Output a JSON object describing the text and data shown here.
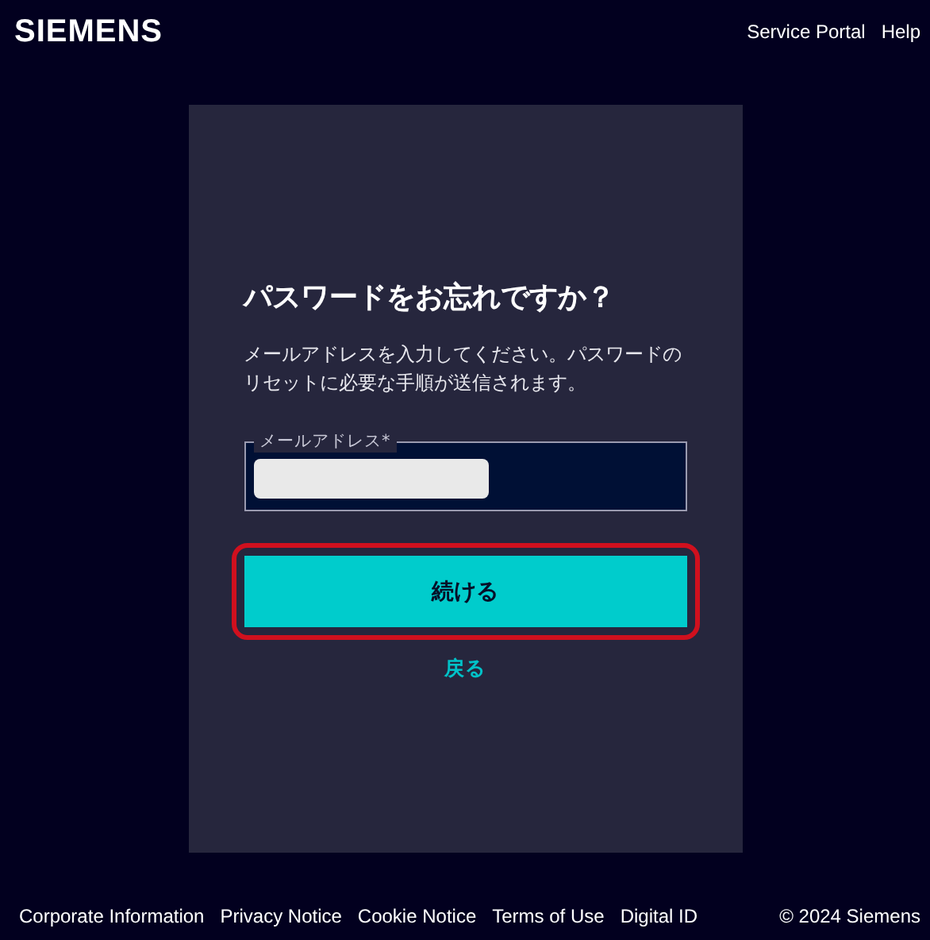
{
  "header": {
    "logo": "SIEMENS",
    "links": [
      "Service Portal",
      "Help"
    ]
  },
  "card": {
    "title": "パスワードをお忘れですか？",
    "description": "メールアドレスを入力してください。パスワードのリセットに必要な手順が送信されます。",
    "email_field": {
      "label": "メールアドレス*",
      "value_redacted": true
    },
    "continue_button": {
      "label": "続ける",
      "highlighted": true
    },
    "back_link": "戻る"
  },
  "footer": {
    "links": [
      "Corporate Information",
      "Privacy Notice",
      "Cookie Notice",
      "Terms of Use",
      "Digital ID"
    ],
    "copyright": "© 2024 Siemens"
  }
}
